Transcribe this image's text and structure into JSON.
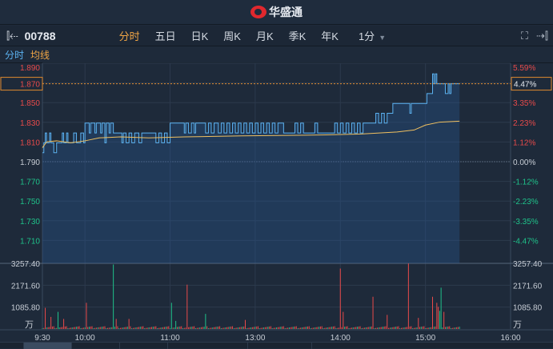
{
  "app": {
    "logo_text": "华盛通"
  },
  "toolbar": {
    "stock_code": "00788",
    "tabs": [
      "分时",
      "五日",
      "日K",
      "周K",
      "月K",
      "季K",
      "年K"
    ],
    "active_tab": "分时",
    "interval": "1分"
  },
  "legend": {
    "line": "分时",
    "avg": "均线"
  },
  "colors": {
    "up": "#e84a4a",
    "down": "#1fc28a",
    "line": "#5cb3f2",
    "avg": "#f0c060",
    "current": "#e08a30"
  },
  "chart_data": {
    "type": "line",
    "prev_close": 1.79,
    "current_price": 1.87,
    "current_pct": "4.47%",
    "price_ticks": [
      "1.890",
      "1.870",
      "1.850",
      "1.830",
      "1.810",
      "1.790",
      "1.770",
      "1.750",
      "1.730",
      "1.710"
    ],
    "pct_ticks": [
      "5.59%",
      "4.47%",
      "3.35%",
      "2.23%",
      "1.12%",
      "0.00%",
      "-1.12%",
      "-2.23%",
      "-3.35%",
      "-4.47%"
    ],
    "volume_ticks": [
      "3257.40",
      "2171.60",
      "1085.80"
    ],
    "volume_unit": "万",
    "volume_max": 3257.4,
    "time_labels": [
      "9:30",
      "10:00",
      "11:00",
      "13:00",
      "14:00",
      "15:00",
      "16:00"
    ],
    "time_minutes": [
      0,
      30,
      90,
      150,
      210,
      270,
      330
    ],
    "price": [
      [
        0,
        1.8
      ],
      [
        1,
        1.81
      ],
      [
        2,
        1.82
      ],
      [
        3,
        1.81
      ],
      [
        5,
        1.82
      ],
      [
        6,
        1.81
      ],
      [
        8,
        1.8
      ],
      [
        10,
        1.81
      ],
      [
        14,
        1.82
      ],
      [
        15,
        1.81
      ],
      [
        17,
        1.82
      ],
      [
        18,
        1.81
      ],
      [
        22,
        1.82
      ],
      [
        24,
        1.81
      ],
      [
        27,
        1.82
      ],
      [
        29,
        1.81
      ],
      [
        30,
        1.83
      ],
      [
        33,
        1.82
      ],
      [
        34,
        1.83
      ],
      [
        37,
        1.82
      ],
      [
        38,
        1.83
      ],
      [
        41,
        1.82
      ],
      [
        42,
        1.83
      ],
      [
        44,
        1.81
      ],
      [
        45,
        1.83
      ],
      [
        47,
        1.82
      ],
      [
        48,
        1.83
      ],
      [
        50,
        1.82
      ],
      [
        56,
        1.81
      ],
      [
        57,
        1.82
      ],
      [
        59,
        1.81
      ],
      [
        61,
        1.82
      ],
      [
        63,
        1.81
      ],
      [
        65,
        1.82
      ],
      [
        68,
        1.81
      ],
      [
        70,
        1.82
      ],
      [
        80,
        1.81
      ],
      [
        82,
        1.82
      ],
      [
        84,
        1.81
      ],
      [
        86,
        1.82
      ],
      [
        88,
        1.81
      ],
      [
        90,
        1.83
      ],
      [
        100,
        1.82
      ],
      [
        101,
        1.83
      ],
      [
        103,
        1.82
      ],
      [
        105,
        1.83
      ],
      [
        107,
        1.82
      ],
      [
        108,
        1.83
      ],
      [
        115,
        1.82
      ],
      [
        117,
        1.83
      ],
      [
        119,
        1.82
      ],
      [
        121,
        1.83
      ],
      [
        124,
        1.82
      ],
      [
        126,
        1.83
      ],
      [
        128,
        1.82
      ],
      [
        130,
        1.83
      ],
      [
        132,
        1.82
      ],
      [
        134,
        1.83
      ],
      [
        136,
        1.82
      ],
      [
        138,
        1.83
      ],
      [
        140,
        1.82
      ],
      [
        142,
        1.83
      ],
      [
        144,
        1.82
      ],
      [
        146,
        1.83
      ],
      [
        148,
        1.82
      ],
      [
        150,
        1.83
      ],
      [
        152,
        1.82
      ],
      [
        154,
        1.83
      ],
      [
        156,
        1.82
      ],
      [
        158,
        1.83
      ],
      [
        160,
        1.82
      ],
      [
        162,
        1.83
      ],
      [
        164,
        1.82
      ],
      [
        166,
        1.83
      ],
      [
        170,
        1.82
      ],
      [
        176,
        1.82
      ],
      [
        178,
        1.83
      ],
      [
        180,
        1.82
      ],
      [
        182,
        1.83
      ],
      [
        184,
        1.82
      ],
      [
        190,
        1.82
      ],
      [
        192,
        1.83
      ],
      [
        194,
        1.82
      ],
      [
        206,
        1.83
      ],
      [
        208,
        1.82
      ],
      [
        210,
        1.83
      ],
      [
        212,
        1.82
      ],
      [
        214,
        1.83
      ],
      [
        216,
        1.82
      ],
      [
        218,
        1.83
      ],
      [
        220,
        1.82
      ],
      [
        222,
        1.83
      ],
      [
        224,
        1.82
      ],
      [
        226,
        1.83
      ],
      [
        235,
        1.84
      ],
      [
        237,
        1.83
      ],
      [
        239,
        1.84
      ],
      [
        241,
        1.83
      ],
      [
        243,
        1.84
      ],
      [
        247,
        1.85
      ],
      [
        259,
        1.84
      ],
      [
        260,
        1.85
      ],
      [
        262,
        1.85
      ],
      [
        271,
        1.86
      ],
      [
        275,
        1.88
      ],
      [
        276,
        1.87
      ],
      [
        277,
        1.88
      ],
      [
        278,
        1.87
      ],
      [
        284,
        1.86
      ],
      [
        286,
        1.87
      ],
      [
        287,
        1.86
      ],
      [
        288,
        1.87
      ],
      [
        294,
        1.87
      ]
    ],
    "average": [
      [
        0,
        1.805
      ],
      [
        3,
        1.811
      ],
      [
        10,
        1.812
      ],
      [
        20,
        1.81
      ],
      [
        30,
        1.812
      ],
      [
        40,
        1.815
      ],
      [
        55,
        1.816
      ],
      [
        75,
        1.815
      ],
      [
        100,
        1.816
      ],
      [
        140,
        1.817
      ],
      [
        200,
        1.818
      ],
      [
        225,
        1.819
      ],
      [
        250,
        1.821
      ],
      [
        262,
        1.823
      ],
      [
        270,
        1.828
      ],
      [
        280,
        1.831
      ],
      [
        294,
        1.832
      ]
    ],
    "volume_highlights": [
      [
        2,
        1050,
        "up"
      ],
      [
        6,
        600,
        "up"
      ],
      [
        11,
        850,
        "down"
      ],
      [
        15,
        500,
        "up"
      ],
      [
        31,
        1300,
        "up"
      ],
      [
        50,
        3200,
        "down"
      ],
      [
        52,
        500,
        "up"
      ],
      [
        61,
        500,
        "up"
      ],
      [
        91,
        1300,
        "down"
      ],
      [
        94,
        400,
        "down"
      ],
      [
        102,
        2200,
        "up"
      ],
      [
        115,
        750,
        "down"
      ],
      [
        143,
        450,
        "up"
      ],
      [
        210,
        3000,
        "up"
      ],
      [
        212,
        850,
        "up"
      ],
      [
        233,
        1600,
        "up"
      ],
      [
        243,
        700,
        "up"
      ],
      [
        258,
        3250,
        "up"
      ],
      [
        265,
        550,
        "up"
      ],
      [
        275,
        1600,
        "up"
      ],
      [
        278,
        1300,
        "up"
      ],
      [
        279,
        1100,
        "up"
      ],
      [
        280,
        900,
        "down"
      ],
      [
        281,
        2050,
        "down"
      ],
      [
        283,
        850,
        "up"
      ]
    ]
  }
}
